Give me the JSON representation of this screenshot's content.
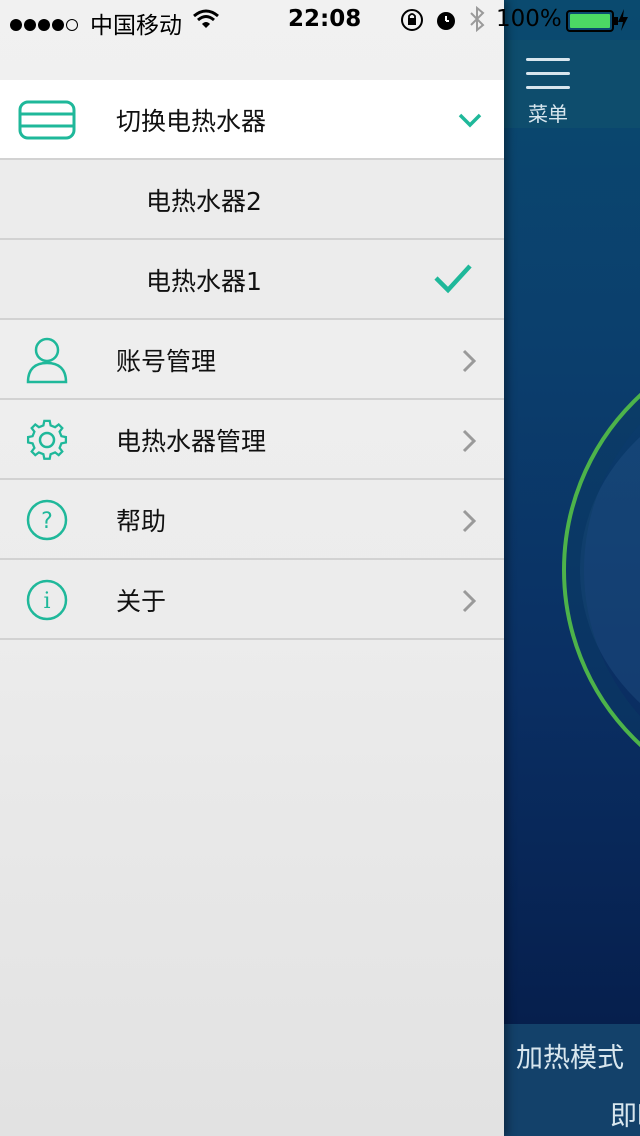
{
  "status_bar": {
    "carrier": "中国移动",
    "time": "22:08",
    "battery": "100%"
  },
  "drawer": {
    "switch_section": {
      "label": "切换电热水器",
      "icon": "water-heater-icon",
      "devices": [
        {
          "label": "电热水器2",
          "selected": false
        },
        {
          "label": "电热水器1",
          "selected": true
        }
      ]
    },
    "menu_items": [
      {
        "label": "账号管理",
        "icon": "user-icon"
      },
      {
        "label": "电热水器管理",
        "icon": "gear-icon"
      },
      {
        "label": "帮助",
        "icon": "help-icon"
      },
      {
        "label": "关于",
        "icon": "info-icon"
      }
    ]
  },
  "background_app": {
    "menu_label": "菜单",
    "mode_label": "加热模式",
    "mode_value": "即时"
  },
  "colors": {
    "accent": "#1fb89a",
    "ring": "#4db34a"
  }
}
